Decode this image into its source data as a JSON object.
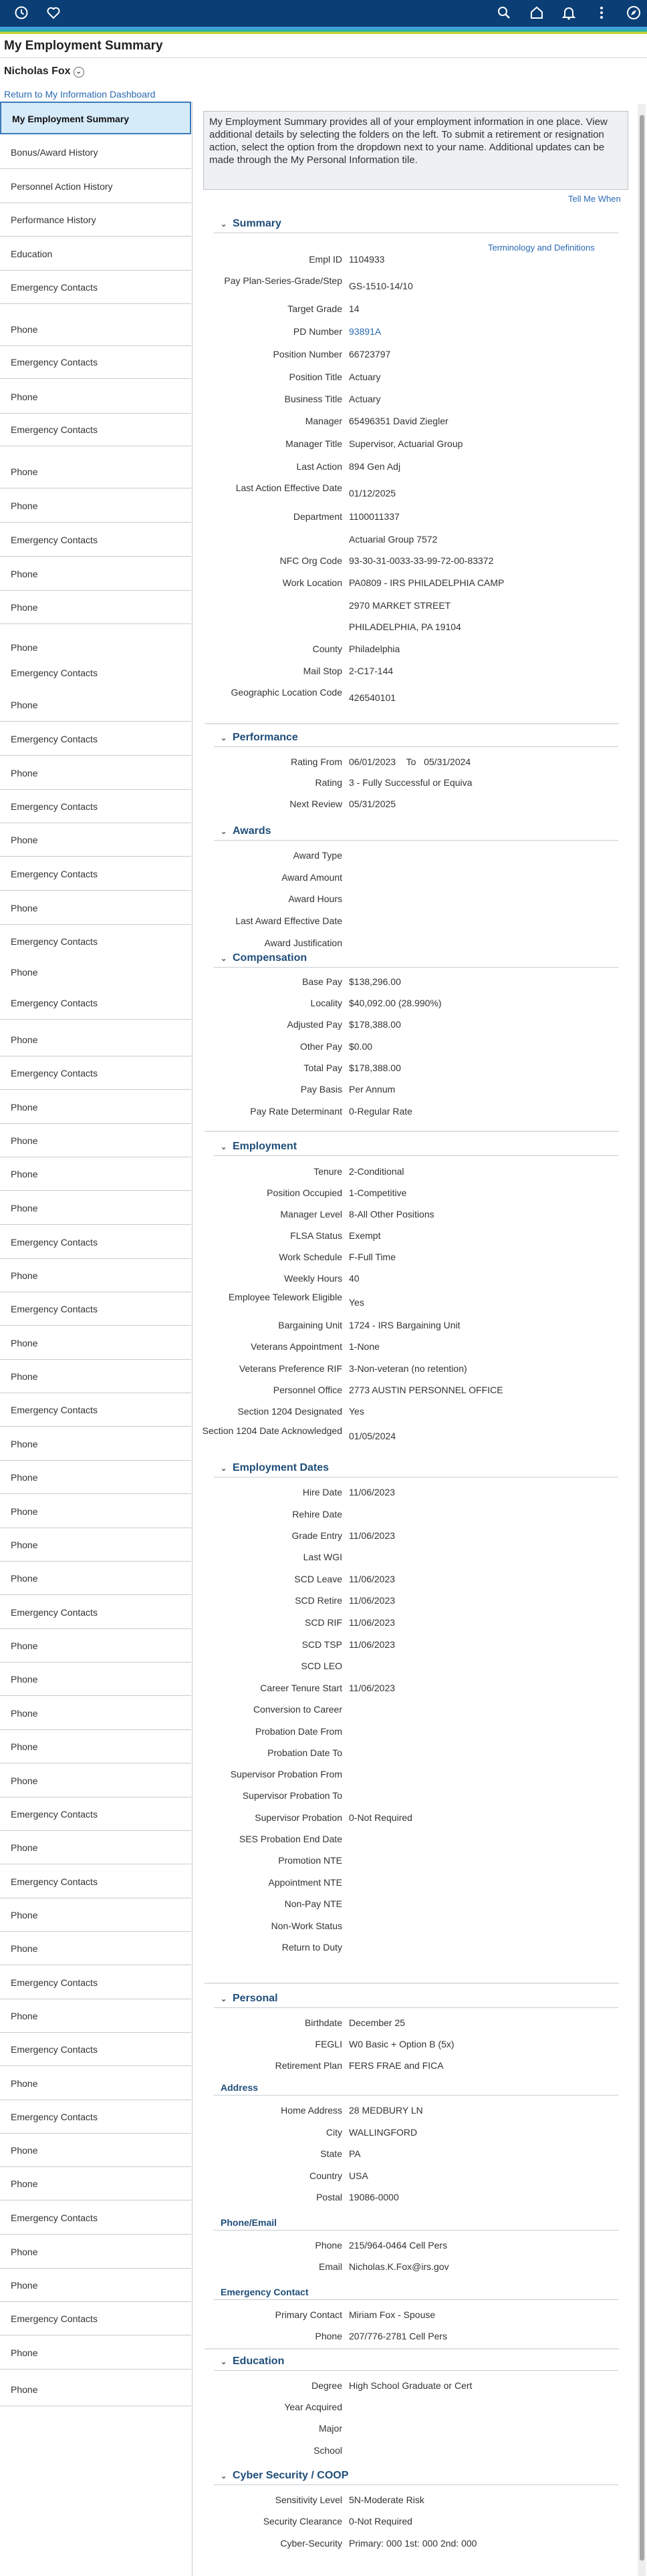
{
  "header": {
    "icons": [
      "history-icon",
      "favorites-icon",
      "search-icon",
      "home-icon",
      "notifications-icon",
      "more-options-icon",
      "navigator-icon"
    ]
  },
  "page_title": "My Employment Summary",
  "employee_name": "Nicholas Fox",
  "return_link": "Return to My Information Dashboard",
  "nav": {
    "items": [
      {
        "label": "My Employment Summary"
      },
      {
        "label": "Bonus/Award History"
      },
      {
        "label": "Personnel Action History"
      },
      {
        "label": "Performance History"
      },
      {
        "label": "Education"
      },
      {
        "label": "Emergency Contacts"
      },
      {
        "label": "Phone"
      },
      {
        "label": "Emergency Contacts"
      },
      {
        "label": "Phone"
      },
      {
        "label": "Emergency Contacts"
      },
      {
        "label": "Phone"
      },
      {
        "label": "Phone"
      },
      {
        "label": "Emergency Contacts"
      },
      {
        "label": "Phone"
      },
      {
        "label": "Phone"
      },
      {
        "label": "Phone"
      },
      {
        "label": "Emergency Contacts"
      },
      {
        "label": "Phone"
      },
      {
        "label": "Emergency Contacts"
      },
      {
        "label": "Phone"
      },
      {
        "label": "Emergency Contacts"
      },
      {
        "label": "Phone"
      },
      {
        "label": "Emergency Contacts"
      },
      {
        "label": "Phone"
      },
      {
        "label": "Emergency Contacts"
      },
      {
        "label": "Phone"
      },
      {
        "label": "Emergency Contacts"
      },
      {
        "label": "Phone"
      },
      {
        "label": "Emergency Contacts"
      },
      {
        "label": "Phone"
      },
      {
        "label": "Phone"
      },
      {
        "label": "Phone"
      },
      {
        "label": "Phone"
      },
      {
        "label": "Emergency Contacts"
      },
      {
        "label": "Phone"
      },
      {
        "label": "Emergency Contacts"
      },
      {
        "label": "Phone"
      },
      {
        "label": "Phone"
      },
      {
        "label": "Emergency Contacts"
      },
      {
        "label": "Phone"
      },
      {
        "label": "Phone"
      },
      {
        "label": "Phone"
      },
      {
        "label": "Phone"
      },
      {
        "label": "Phone"
      },
      {
        "label": "Emergency Contacts"
      },
      {
        "label": "Phone"
      },
      {
        "label": "Phone"
      },
      {
        "label": "Phone"
      },
      {
        "label": "Phone"
      },
      {
        "label": "Phone"
      },
      {
        "label": "Emergency Contacts"
      },
      {
        "label": "Phone"
      },
      {
        "label": "Emergency Contacts"
      },
      {
        "label": "Phone"
      },
      {
        "label": "Phone"
      },
      {
        "label": "Emergency Contacts"
      },
      {
        "label": "Phone"
      },
      {
        "label": "Emergency Contacts"
      },
      {
        "label": "Phone"
      },
      {
        "label": "Emergency Contacts"
      },
      {
        "label": "Phone"
      },
      {
        "label": "Phone"
      },
      {
        "label": "Emergency Contacts"
      },
      {
        "label": "Phone"
      },
      {
        "label": "Phone"
      },
      {
        "label": "Emergency Contacts"
      },
      {
        "label": "Phone"
      },
      {
        "label": "Emergency Contacts"
      },
      {
        "label": "Phone"
      }
    ]
  },
  "intro_text": "My Employment Summary provides all of your employment information in one place.  View additional details by selecting the folders on the left. To submit a retirement or resignation action, select the option from the dropdown next to your name. Additional updates can be made through the My Personal Information tile.",
  "tell_me_when": "Tell Me When",
  "terms_link": "Terminology and Definitions",
  "sections": {
    "summary": {
      "title": "Summary",
      "rows": [
        {
          "label": "Empl ID",
          "value": "1104933"
        },
        {
          "label": "Pay Plan-Series-Grade/Step",
          "value": "GS-1510-14/10"
        },
        {
          "label": "Target Grade",
          "value": "14"
        },
        {
          "label": "PD Number",
          "value": "93891A"
        },
        {
          "label": "Position Number",
          "value": "66723797"
        },
        {
          "label": "Position Title",
          "value": "Actuary"
        },
        {
          "label": "Business Title",
          "value": "Actuary"
        },
        {
          "label": "Manager",
          "value": "65496351 David Ziegler"
        },
        {
          "label": "Manager Title",
          "value": "Supervisor, Actuarial Group"
        },
        {
          "label": "Last Action",
          "value": "894    Gen Adj"
        },
        {
          "label": "Last Action Effective Date",
          "value": "01/12/2025"
        },
        {
          "label": "Department",
          "value": "1100011337"
        },
        {
          "label": "",
          "value": "Actuarial Group 7572"
        },
        {
          "label": "NFC Org Code",
          "value": "93-30-31-0033-33-99-72-00-83372"
        },
        {
          "label": "Work Location",
          "value": "PA0809 - IRS PHILADELPHIA CAMP"
        },
        {
          "label": "",
          "value": "2970 MARKET STREET"
        },
        {
          "label": "",
          "value": "PHILADELPHIA, PA 19104"
        },
        {
          "label": "County",
          "value": "Philadelphia"
        },
        {
          "label": "Mail Stop",
          "value": "2-C17-144"
        },
        {
          "label": "Geographic Location Code",
          "value": "426540101"
        }
      ]
    },
    "performance": {
      "title": "Performance",
      "rating_from_label": "Rating From",
      "rating_from": "06/01/2023",
      "to_label": "To",
      "rating_to": "05/31/2024",
      "rows": [
        {
          "label": "Rating",
          "value": "3 - Fully Successful or Equiva"
        },
        {
          "label": "Next Review",
          "value": "05/31/2025"
        }
      ]
    },
    "awards": {
      "title": "Awards",
      "rows": [
        {
          "label": "Award Type",
          "value": ""
        },
        {
          "label": "Award Amount",
          "value": ""
        },
        {
          "label": "Award Hours",
          "value": ""
        },
        {
          "label": "Last Award Effective Date",
          "value": ""
        },
        {
          "label": "Award Justification",
          "value": ""
        }
      ]
    },
    "compensation": {
      "title": "Compensation",
      "rows": [
        {
          "label": "Base Pay",
          "value": "$138,296.00"
        },
        {
          "label": "Locality",
          "value": "$40,092.00 (28.990%)"
        },
        {
          "label": "Adjusted Pay",
          "value": "$178,388.00"
        },
        {
          "label": "Other Pay",
          "value": "$0.00"
        },
        {
          "label": "Total Pay",
          "value": "$178,388.00"
        },
        {
          "label": "Pay Basis",
          "value": "Per Annum"
        },
        {
          "label": "Pay Rate Determinant",
          "value": "0-Regular Rate"
        }
      ]
    },
    "employment": {
      "title": "Employment",
      "rows": [
        {
          "label": "Tenure",
          "value": "2-Conditional"
        },
        {
          "label": "Position Occupied",
          "value": "1-Competitive"
        },
        {
          "label": "Manager Level",
          "value": "8-All Other Positions"
        },
        {
          "label": "FLSA Status",
          "value": "Exempt"
        },
        {
          "label": "Work Schedule",
          "value": "F-Full Time"
        },
        {
          "label": "Weekly Hours",
          "value": "40"
        },
        {
          "label": "Employee Telework Eligible",
          "value": "Yes"
        },
        {
          "label": "Bargaining Unit",
          "value": "1724 - IRS Bargaining Unit"
        },
        {
          "label": "Veterans Appointment",
          "value": "1-None"
        },
        {
          "label": "Veterans Preference RIF",
          "value": "3-Non-veteran (no retention)"
        },
        {
          "label": "Personnel Office",
          "value": "2773 AUSTIN PERSONNEL OFFICE"
        },
        {
          "label": "Section 1204 Designated",
          "value": "Yes"
        },
        {
          "label": "Section 1204 Date Acknowledged",
          "value": "01/05/2024"
        }
      ]
    },
    "employment_dates": {
      "title": "Employment Dates",
      "rows": [
        {
          "label": "Hire Date",
          "value": "11/06/2023"
        },
        {
          "label": "Rehire Date",
          "value": ""
        },
        {
          "label": "Grade Entry",
          "value": "11/06/2023"
        },
        {
          "label": "Last WGI",
          "value": ""
        },
        {
          "label": "SCD Leave",
          "value": "11/06/2023"
        },
        {
          "label": "SCD Retire",
          "value": "11/06/2023"
        },
        {
          "label": "SCD RIF",
          "value": "11/06/2023"
        },
        {
          "label": "SCD TSP",
          "value": "11/06/2023"
        },
        {
          "label": "SCD LEO",
          "value": ""
        },
        {
          "label": "Career Tenure Start",
          "value": "11/06/2023"
        },
        {
          "label": "Conversion to Career",
          "value": ""
        },
        {
          "label": "Probation Date From",
          "value": ""
        },
        {
          "label": "Probation Date To",
          "value": ""
        },
        {
          "label": "Supervisor Probation From",
          "value": ""
        },
        {
          "label": "Supervisor Probation To",
          "value": ""
        },
        {
          "label": "Supervisor Probation",
          "value": "0-Not Required"
        },
        {
          "label": "SES Probation End Date",
          "value": ""
        },
        {
          "label": "Promotion NTE",
          "value": ""
        },
        {
          "label": "Appointment NTE",
          "value": ""
        },
        {
          "label": "Non-Pay NTE",
          "value": ""
        },
        {
          "label": "Non-Work Status",
          "value": ""
        },
        {
          "label": "Return to Duty",
          "value": ""
        }
      ]
    },
    "personal": {
      "title": "Personal",
      "rows": [
        {
          "label": "Birthdate",
          "value": "December 25"
        },
        {
          "label": "FEGLI",
          "value": "W0 Basic + Option B (5x)"
        },
        {
          "label": "Retirement Plan",
          "value": "FERS FRAE and FICA"
        }
      ],
      "address_title": "Address",
      "address_rows": [
        {
          "label": "Home Address",
          "value": "28 MEDBURY LN"
        },
        {
          "label": "City",
          "value": "WALLINGFORD"
        },
        {
          "label": "State",
          "value": "PA"
        },
        {
          "label": "Country",
          "value": "USA"
        },
        {
          "label": "Postal",
          "value": "19086-0000"
        }
      ],
      "phone_title": "Phone/Email",
      "phone_rows": [
        {
          "label": "Phone",
          "value": "215/964-0464 Cell Pers"
        },
        {
          "label": "Email",
          "value": "Nicholas.K.Fox@irs.gov"
        }
      ],
      "emergency_title": "Emergency Contact",
      "emergency_rows": [
        {
          "label": "Primary Contact",
          "value": "Miriam Fox - Spouse"
        },
        {
          "label": "Phone",
          "value": "207/776-2781 Cell Pers"
        }
      ]
    },
    "education": {
      "title": "Education",
      "rows": [
        {
          "label": "Degree",
          "value": "High School Graduate or Cert"
        },
        {
          "label": "Year Acquired",
          "value": ""
        },
        {
          "label": "Major",
          "value": ""
        },
        {
          "label": "School",
          "value": ""
        }
      ]
    },
    "cyber": {
      "title": "Cyber Security / COOP",
      "rows": [
        {
          "label": "Sensitivity Level",
          "value": "5N-Moderate Risk"
        },
        {
          "label": "Security Clearance",
          "value": "0-Not Required"
        },
        {
          "label": "Cyber-Security",
          "value": "Primary: 000 1st: 000 2nd: 000"
        }
      ]
    }
  }
}
